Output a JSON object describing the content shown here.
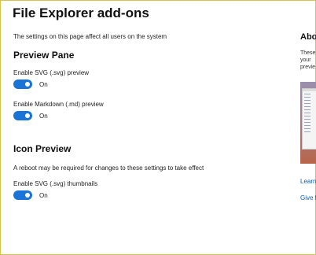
{
  "page": {
    "title": "File Explorer add-ons",
    "description": "The settings on this page affect all users on the system"
  },
  "preview_pane": {
    "title": "Preview Pane",
    "svg_preview": {
      "label": "Enable SVG (.svg) preview",
      "state": "On",
      "enabled": true
    },
    "markdown_preview": {
      "label": "Enable Markdown (.md) preview",
      "state": "On",
      "enabled": true
    }
  },
  "icon_preview": {
    "title": "Icon Preview",
    "description": "A reboot may be required for changes to these settings to take effect",
    "svg_thumbnails": {
      "label": "Enable SVG (.svg) thumbnails",
      "state": "On",
      "enabled": true
    }
  },
  "about": {
    "title": "Abo",
    "text_lines": [
      "These",
      "your",
      "previe"
    ],
    "learn_link": "Learn",
    "give_link": "Give f"
  },
  "colors": {
    "toggle_on": "#1a73d6",
    "link": "#0a5fb4"
  }
}
